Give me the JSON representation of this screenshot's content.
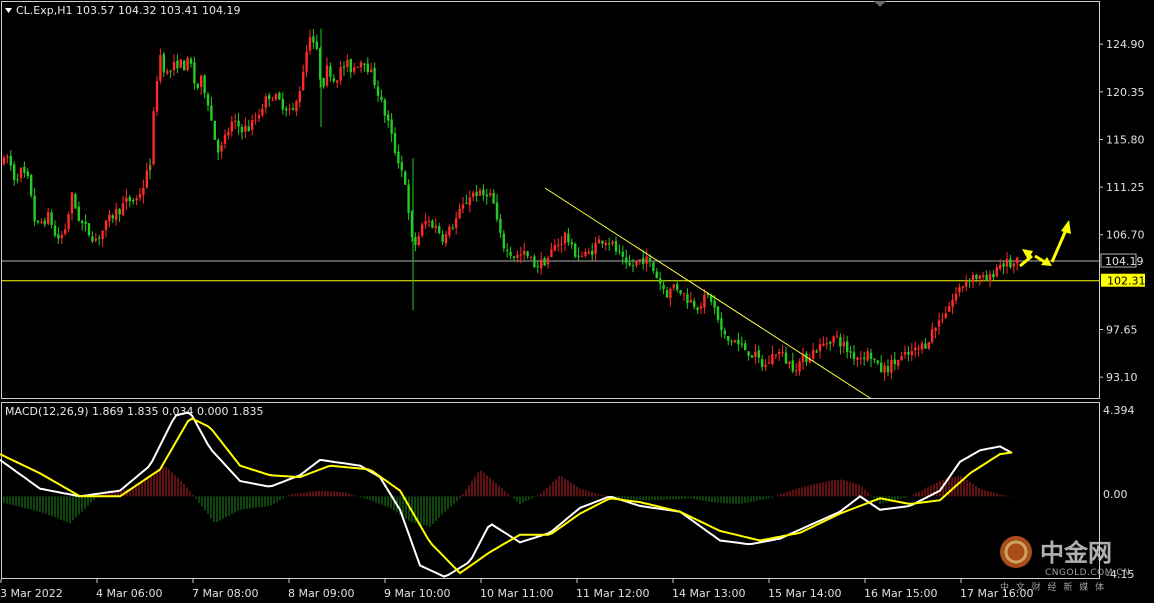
{
  "header": {
    "symbol_line": "CL.Exp,H1  103.57 104.32 103.41 104.19",
    "menu_icon": "triangle-down-icon"
  },
  "price_panel": {
    "current_price_label": "104.19",
    "highlight_price_label": "102.31",
    "current_price": 104.19,
    "highlight_price": 102.31,
    "line_color_current": "#b0b0b0",
    "line_color_highlight": "#ffff00"
  },
  "macd_panel": {
    "header": "MACD(12,26,9) 1.869 1.835 0.034 0.000 1.835",
    "max_label": "4.394",
    "zero_label": "0.00",
    "min_label": "-4.15"
  },
  "colors": {
    "bull_candle": "#ff2a2a",
    "bear_candle": "#22cc22",
    "signal_line": "#ffff00",
    "macd_line": "#ffffff",
    "hist_pos": "#c02020",
    "hist_neg": "#1a8a1a",
    "trendline": "#ffff40",
    "arrow": "#ffff00",
    "grid_border": "#cfcfcf"
  },
  "logo": {
    "name": "中金网",
    "url": "CNGOLD.COM.CN",
    "tagline": "中 文 财 经 新 媒 体"
  },
  "chart_data": [
    {
      "type": "candlestick",
      "title": "CL.Exp,H1",
      "x_ticks": [
        "3 Mar 2022",
        "4 Mar 06:00",
        "7 Mar 08:00",
        "8 Mar 09:00",
        "9 Mar 10:00",
        "10 Mar 11:00",
        "11 Mar 12:00",
        "14 Mar 13:00",
        "15 Mar 14:00",
        "16 Mar 15:00",
        "17 Mar 16:00"
      ],
      "y_ticks": [
        124.9,
        120.35,
        115.8,
        111.25,
        106.7,
        97.65,
        93.1
      ],
      "ylim": [
        91.3,
        127.4
      ],
      "price_path": [
        [
          0,
          113.0
        ],
        [
          8,
          114.2
        ],
        [
          14,
          112.2
        ],
        [
          22,
          112.8
        ],
        [
          30,
          111.5
        ],
        [
          36,
          107.2
        ],
        [
          42,
          108.0
        ],
        [
          50,
          108.5
        ],
        [
          56,
          106.2
        ],
        [
          64,
          106.8
        ],
        [
          72,
          110.3
        ],
        [
          80,
          108.0
        ],
        [
          88,
          107.0
        ],
        [
          96,
          106.3
        ],
        [
          104,
          107.3
        ],
        [
          112,
          108.5
        ],
        [
          120,
          109.2
        ],
        [
          128,
          110.0
        ],
        [
          136,
          110.0
        ],
        [
          144,
          111.5
        ],
        [
          150,
          113.5
        ],
        [
          156,
          121.0
        ],
        [
          160,
          124.0
        ],
        [
          166,
          122.0
        ],
        [
          172,
          122.5
        ],
        [
          178,
          123.2
        ],
        [
          184,
          122.8
        ],
        [
          190,
          123.3
        ],
        [
          196,
          120.5
        ],
        [
          202,
          121.5
        ],
        [
          208,
          119.5
        ],
        [
          214,
          116.2
        ],
        [
          220,
          114.5
        ],
        [
          226,
          116.2
        ],
        [
          232,
          117.3
        ],
        [
          240,
          117.0
        ],
        [
          248,
          116.8
        ],
        [
          256,
          117.8
        ],
        [
          262,
          119.0
        ],
        [
          270,
          120.2
        ],
        [
          278,
          119.5
        ],
        [
          286,
          119.0
        ],
        [
          294,
          118.3
        ],
        [
          300,
          120.8
        ],
        [
          306,
          124.0
        ],
        [
          310,
          126.0
        ],
        [
          316,
          124.5
        ],
        [
          322,
          120.8
        ],
        [
          328,
          122.8
        ],
        [
          334,
          121.5
        ],
        [
          340,
          122.3
        ],
        [
          346,
          123.0
        ],
        [
          352,
          122.5
        ],
        [
          358,
          123.2
        ],
        [
          364,
          123.5
        ],
        [
          370,
          122.3
        ],
        [
          376,
          121.0
        ],
        [
          382,
          119.0
        ],
        [
          388,
          117.5
        ],
        [
          394,
          115.0
        ],
        [
          400,
          113.5
        ],
        [
          406,
          111.5
        ],
        [
          410,
          106.8
        ],
        [
          414,
          105.5
        ],
        [
          420,
          107.0
        ],
        [
          426,
          108.0
        ],
        [
          432,
          107.8
        ],
        [
          438,
          107.2
        ],
        [
          444,
          106.3
        ],
        [
          452,
          107.5
        ],
        [
          458,
          108.5
        ],
        [
          464,
          109.5
        ],
        [
          470,
          110.5
        ],
        [
          476,
          110.8
        ],
        [
          482,
          110.3
        ],
        [
          488,
          111.0
        ],
        [
          494,
          109.5
        ],
        [
          500,
          106.5
        ],
        [
          506,
          105.2
        ],
        [
          512,
          104.8
        ],
        [
          518,
          104.6
        ],
        [
          524,
          104.8
        ],
        [
          530,
          104.3
        ],
        [
          536,
          103.8
        ],
        [
          542,
          104.0
        ],
        [
          548,
          104.5
        ],
        [
          554,
          105.5
        ],
        [
          560,
          106.0
        ],
        [
          566,
          106.8
        ],
        [
          572,
          105.2
        ],
        [
          578,
          104.9
        ],
        [
          584,
          104.6
        ],
        [
          590,
          105.0
        ],
        [
          596,
          105.8
        ],
        [
          602,
          106.3
        ],
        [
          608,
          106.2
        ],
        [
          614,
          105.5
        ],
        [
          620,
          104.6
        ],
        [
          626,
          103.5
        ],
        [
          632,
          103.7
        ],
        [
          638,
          104.2
        ],
        [
          644,
          104.5
        ],
        [
          650,
          103.9
        ],
        [
          656,
          102.9
        ],
        [
          662,
          101.8
        ],
        [
          668,
          101.0
        ],
        [
          674,
          101.9
        ],
        [
          680,
          101.5
        ],
        [
          686,
          100.7
        ],
        [
          692,
          100.3
        ],
        [
          698,
          100.0
        ],
        [
          704,
          100.5
        ],
        [
          710,
          100.9
        ],
        [
          716,
          99.2
        ],
        [
          722,
          97.2
        ],
        [
          728,
          96.5
        ],
        [
          734,
          96.7
        ],
        [
          740,
          96.0
        ],
        [
          746,
          95.8
        ],
        [
          752,
          95.3
        ],
        [
          758,
          94.8
        ],
        [
          764,
          94.0
        ],
        [
          770,
          94.8
        ],
        [
          776,
          95.6
        ],
        [
          782,
          95.2
        ],
        [
          788,
          94.5
        ],
        [
          794,
          94.1
        ],
        [
          800,
          94.5
        ],
        [
          806,
          95.0
        ],
        [
          812,
          95.5
        ],
        [
          818,
          95.9
        ],
        [
          824,
          96.2
        ],
        [
          830,
          96.8
        ],
        [
          836,
          96.9
        ],
        [
          842,
          96.3
        ],
        [
          848,
          95.6
        ],
        [
          854,
          95.2
        ],
        [
          860,
          95.0
        ],
        [
          866,
          95.4
        ],
        [
          872,
          95.1
        ],
        [
          878,
          93.9
        ],
        [
          884,
          93.8
        ],
        [
          890,
          94.2
        ],
        [
          896,
          94.6
        ],
        [
          902,
          94.9
        ],
        [
          908,
          95.2
        ],
        [
          914,
          95.5
        ],
        [
          920,
          95.9
        ],
        [
          926,
          96.4
        ],
        [
          932,
          97.4
        ],
        [
          938,
          98.3
        ],
        [
          944,
          99.2
        ],
        [
          950,
          100.1
        ],
        [
          956,
          101.0
        ],
        [
          962,
          101.9
        ],
        [
          968,
          102.6
        ],
        [
          974,
          102.8
        ],
        [
          980,
          102.5
        ],
        [
          986,
          102.3
        ],
        [
          990,
          102.5
        ],
        [
          996,
          103.6
        ],
        [
          1002,
          104.0
        ],
        [
          1008,
          103.9
        ],
        [
          1014,
          103.8
        ],
        [
          1020,
          104.19
        ]
      ]
    },
    {
      "type": "line",
      "title": "MACD(12,26,9)",
      "series": [
        {
          "name": "MACD",
          "values_path": [
            [
              0,
              1.9
            ],
            [
              40,
              0.4
            ],
            [
              80,
              0.0
            ],
            [
              120,
              0.3
            ],
            [
              150,
              1.6
            ],
            [
              175,
              4.2
            ],
            [
              190,
              4.4
            ],
            [
              210,
              2.5
            ],
            [
              240,
              0.8
            ],
            [
              270,
              0.5
            ],
            [
              300,
              1.1
            ],
            [
              320,
              1.9
            ],
            [
              360,
              1.6
            ],
            [
              380,
              1.0
            ],
            [
              400,
              -0.7
            ],
            [
              420,
              -3.6
            ],
            [
              445,
              -4.2
            ],
            [
              470,
              -3.4
            ],
            [
              490,
              -1.4
            ],
            [
              520,
              -2.4
            ],
            [
              550,
              -1.9
            ],
            [
              580,
              -0.6
            ],
            [
              610,
              0.0
            ],
            [
              640,
              -0.5
            ],
            [
              680,
              -0.8
            ],
            [
              720,
              -2.3
            ],
            [
              750,
              -2.5
            ],
            [
              780,
              -2.2
            ],
            [
              810,
              -1.5
            ],
            [
              840,
              -0.8
            ],
            [
              860,
              0.0
            ],
            [
              880,
              -0.7
            ],
            [
              910,
              -0.5
            ],
            [
              940,
              0.3
            ],
            [
              960,
              1.8
            ],
            [
              980,
              2.4
            ],
            [
              1000,
              2.6
            ],
            [
              1014,
              2.2
            ]
          ]
        },
        {
          "name": "Signal",
          "values_path": [
            [
              0,
              2.2
            ],
            [
              40,
              1.2
            ],
            [
              80,
              0.0
            ],
            [
              120,
              0.0
            ],
            [
              160,
              1.4
            ],
            [
              190,
              4.1
            ],
            [
              210,
              3.6
            ],
            [
              240,
              1.6
            ],
            [
              270,
              1.1
            ],
            [
              300,
              1.0
            ],
            [
              330,
              1.6
            ],
            [
              370,
              1.4
            ],
            [
              400,
              0.3
            ],
            [
              430,
              -2.4
            ],
            [
              460,
              -4.0
            ],
            [
              490,
              -2.9
            ],
            [
              520,
              -2.0
            ],
            [
              550,
              -2.0
            ],
            [
              580,
              -0.9
            ],
            [
              610,
              -0.1
            ],
            [
              640,
              -0.3
            ],
            [
              680,
              -0.8
            ],
            [
              720,
              -1.8
            ],
            [
              760,
              -2.3
            ],
            [
              800,
              -1.9
            ],
            [
              840,
              -0.9
            ],
            [
              880,
              -0.1
            ],
            [
              910,
              -0.4
            ],
            [
              940,
              -0.2
            ],
            [
              970,
              1.2
            ],
            [
              1000,
              2.2
            ],
            [
              1014,
              2.3
            ]
          ]
        },
        {
          "name": "Histogram",
          "values_path": [
            [
              0,
              -0.3
            ],
            [
              40,
              -0.8
            ],
            [
              70,
              -1.4
            ],
            [
              100,
              0.1
            ],
            [
              130,
              0.4
            ],
            [
              165,
              1.6
            ],
            [
              185,
              0.6
            ],
            [
              200,
              -0.4
            ],
            [
              215,
              -1.4
            ],
            [
              240,
              -0.7
            ],
            [
              270,
              -0.5
            ],
            [
              290,
              0.1
            ],
            [
              320,
              0.3
            ],
            [
              345,
              0.2
            ],
            [
              370,
              -0.2
            ],
            [
              390,
              -0.6
            ],
            [
              410,
              -1.3
            ],
            [
              430,
              -1.6
            ],
            [
              445,
              -0.8
            ],
            [
              460,
              -0.1
            ],
            [
              480,
              1.4
            ],
            [
              500,
              0.5
            ],
            [
              520,
              -0.4
            ],
            [
              540,
              0.1
            ],
            [
              560,
              1.1
            ],
            [
              580,
              0.4
            ],
            [
              600,
              0.1
            ],
            [
              620,
              -0.1
            ],
            [
              640,
              -0.2
            ],
            [
              660,
              -0.2
            ],
            [
              690,
              -0.1
            ],
            [
              710,
              -0.3
            ],
            [
              740,
              -0.4
            ],
            [
              770,
              -0.1
            ],
            [
              790,
              0.3
            ],
            [
              810,
              0.6
            ],
            [
              840,
              0.9
            ],
            [
              860,
              0.6
            ],
            [
              880,
              -0.4
            ],
            [
              910,
              0.0
            ],
            [
              940,
              0.8
            ],
            [
              960,
              1.1
            ],
            [
              980,
              0.4
            ],
            [
              1000,
              0.1
            ],
            [
              1014,
              0.0
            ]
          ]
        }
      ],
      "ylim": [
        -4.15,
        4.394
      ],
      "y_ticks": [
        4.394,
        0.0,
        -4.15
      ]
    }
  ]
}
